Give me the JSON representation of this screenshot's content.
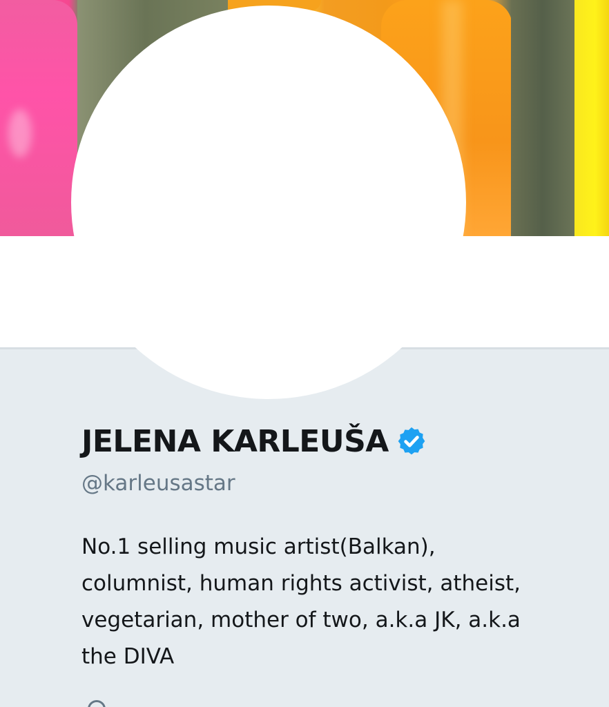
{
  "profile": {
    "display_name": "JELENA KARLEUŠA",
    "verified": true,
    "handle": "@karleusastar",
    "bio_lines": [
      "No.1 selling music artist(Balkan),",
      "columnist, human rights activist, atheist,",
      "vegetarian, mother of two, a.k.a JK, a.k.a",
      "the DIVA"
    ]
  },
  "icons": {
    "verified": "verified-badge-icon",
    "location": "location-pin-icon"
  },
  "colors": {
    "page_background": "#e6ecf0",
    "name_text": "#14171a",
    "handle_text": "#657786",
    "verified_blue": "#1da1f2"
  }
}
